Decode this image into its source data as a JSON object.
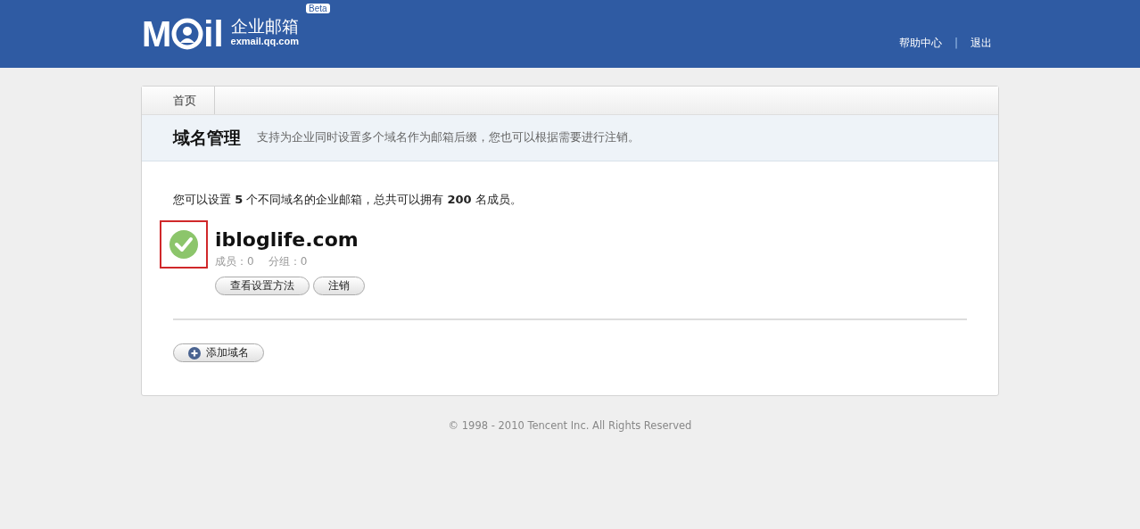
{
  "header": {
    "logo": {
      "left": "M",
      "right": "il",
      "product": "企业邮箱",
      "domain": "exmail.qq.com",
      "badge": "Beta"
    },
    "links": [
      {
        "label": "帮助中心"
      },
      {
        "label": "退出"
      }
    ],
    "separator": "|"
  },
  "breadcrumb": [
    {
      "label": "首页"
    }
  ],
  "section": {
    "title": "域名管理",
    "description": "支持为企业同时设置多个域名作为邮箱后缀，您也可以根据需要进行注销。"
  },
  "summary": "您可以设置 **5** 个不同域名的企业邮箱，总共可以拥有 **200** 名成员。",
  "domains": [
    {
      "name": "ibloglife.com",
      "verified": true,
      "highlighted": true,
      "stats": [
        "成员：0",
        "分组：0"
      ],
      "buttons": [
        "查看设置方法",
        "注销"
      ]
    }
  ],
  "add_button": "添加域名",
  "footer": "© 1998 - 2010 Tencent Inc. All Rights Reserved"
}
